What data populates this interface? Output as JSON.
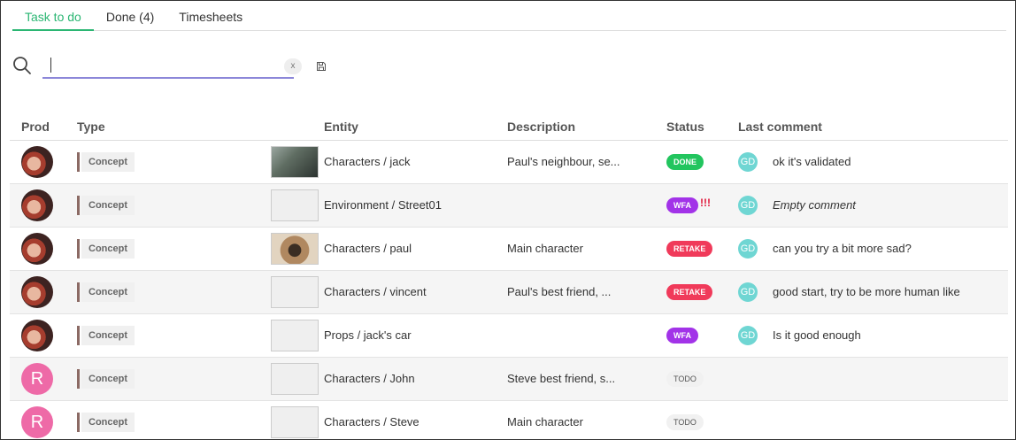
{
  "tabs": [
    {
      "label": "Task to do",
      "active": true
    },
    {
      "label": "Done (4)",
      "active": false
    },
    {
      "label": "Timesheets",
      "active": false
    }
  ],
  "search": {
    "placeholder": "",
    "value": "",
    "clear_label": "x"
  },
  "columns": {
    "prod": "Prod",
    "type": "Type",
    "entity": "Entity",
    "description": "Description",
    "status": "Status",
    "last_comment": "Last comment"
  },
  "rows": [
    {
      "prod": {
        "kind": "photo"
      },
      "type": "Concept",
      "thumb": "cat",
      "entity": "Characters / jack",
      "description": "Paul's neighbour, se...",
      "status": "DONE",
      "status_kind": "done",
      "alert": "",
      "comment_initials": "GD",
      "comment": "ok it's validated",
      "comment_empty": false
    },
    {
      "prod": {
        "kind": "photo"
      },
      "type": "Concept",
      "thumb": "none",
      "entity": "Environment / Street01",
      "description": "",
      "status": "WFA",
      "status_kind": "wfa",
      "alert": "!!!",
      "comment_initials": "GD",
      "comment": "Empty comment",
      "comment_empty": true
    },
    {
      "prod": {
        "kind": "photo"
      },
      "type": "Concept",
      "thumb": "pug",
      "entity": "Characters / paul",
      "description": "Main character",
      "status": "RETAKE",
      "status_kind": "retake",
      "alert": "",
      "comment_initials": "GD",
      "comment": "can you try a bit more sad?",
      "comment_empty": false
    },
    {
      "prod": {
        "kind": "photo"
      },
      "type": "Concept",
      "thumb": "none",
      "entity": "Characters / vincent",
      "description": "Paul's best friend, ...",
      "status": "RETAKE",
      "status_kind": "retake",
      "alert": "",
      "comment_initials": "GD",
      "comment": "good start, try to be more human like",
      "comment_empty": false
    },
    {
      "prod": {
        "kind": "photo"
      },
      "type": "Concept",
      "thumb": "none",
      "entity": "Props / jack's car",
      "description": "",
      "status": "WFA",
      "status_kind": "wfa",
      "alert": "",
      "comment_initials": "GD",
      "comment": "Is it good enough",
      "comment_empty": false
    },
    {
      "prod": {
        "kind": "letter",
        "letter": "R"
      },
      "type": "Concept",
      "thumb": "none",
      "entity": "Characters / John",
      "description": "Steve best friend, s...",
      "status": "TODO",
      "status_kind": "todo",
      "alert": "",
      "comment_initials": "",
      "comment": "",
      "comment_empty": false
    },
    {
      "prod": {
        "kind": "letter",
        "letter": "R"
      },
      "type": "Concept",
      "thumb": "none",
      "entity": "Characters / Steve",
      "description": "Main character",
      "status": "TODO",
      "status_kind": "todo",
      "alert": "",
      "comment_initials": "",
      "comment": "",
      "comment_empty": false
    }
  ],
  "colors": {
    "accent": "#2bb673",
    "done": "#22c55e",
    "wfa": "#a233e8",
    "retake": "#f03a5a",
    "type_bar": "#8b6a64",
    "comment_avatar": "#6fd6d3",
    "prod_letter_avatar": "#ee6aa7"
  }
}
